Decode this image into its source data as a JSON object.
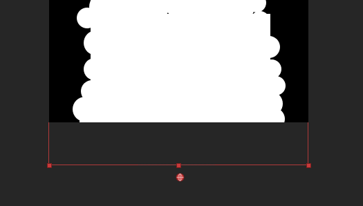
{
  "canvas": {
    "background_color": "#262626",
    "image_background": "#000000",
    "mask_color": "#ffffff"
  },
  "selection": {
    "frame_color": "#b13a3a",
    "handle_color": "#c83a3a",
    "handles": [
      "bottom-left",
      "bottom-middle",
      "bottom-right"
    ],
    "move_icon": "crosshair-globe-icon"
  }
}
